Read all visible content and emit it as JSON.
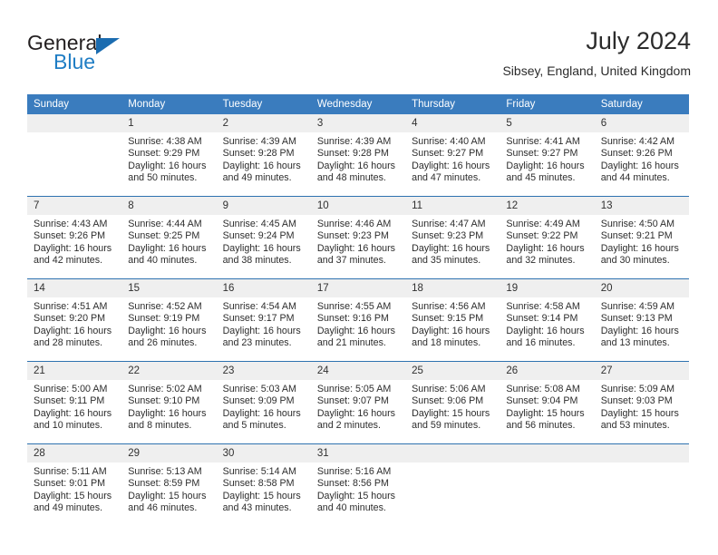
{
  "brand": {
    "name_part1": "General",
    "name_part2": "Blue",
    "flag_icon": "triangle-flag-icon"
  },
  "header": {
    "title": "July 2024",
    "location": "Sibsey, England, United Kingdom"
  },
  "colors": {
    "header_blue": "#3a7cbe",
    "row_divider_blue": "#2e72b0",
    "daynum_band": "#efefef",
    "brand_blue": "#1f7dc4"
  },
  "weekdays": [
    "Sunday",
    "Monday",
    "Tuesday",
    "Wednesday",
    "Thursday",
    "Friday",
    "Saturday"
  ],
  "weeks": [
    [
      {
        "day": "",
        "sunrise": "",
        "sunset": "",
        "daylight_line1": "",
        "daylight_line2": ""
      },
      {
        "day": "1",
        "sunrise": "Sunrise: 4:38 AM",
        "sunset": "Sunset: 9:29 PM",
        "daylight_line1": "Daylight: 16 hours",
        "daylight_line2": "and 50 minutes."
      },
      {
        "day": "2",
        "sunrise": "Sunrise: 4:39 AM",
        "sunset": "Sunset: 9:28 PM",
        "daylight_line1": "Daylight: 16 hours",
        "daylight_line2": "and 49 minutes."
      },
      {
        "day": "3",
        "sunrise": "Sunrise: 4:39 AM",
        "sunset": "Sunset: 9:28 PM",
        "daylight_line1": "Daylight: 16 hours",
        "daylight_line2": "and 48 minutes."
      },
      {
        "day": "4",
        "sunrise": "Sunrise: 4:40 AM",
        "sunset": "Sunset: 9:27 PM",
        "daylight_line1": "Daylight: 16 hours",
        "daylight_line2": "and 47 minutes."
      },
      {
        "day": "5",
        "sunrise": "Sunrise: 4:41 AM",
        "sunset": "Sunset: 9:27 PM",
        "daylight_line1": "Daylight: 16 hours",
        "daylight_line2": "and 45 minutes."
      },
      {
        "day": "6",
        "sunrise": "Sunrise: 4:42 AM",
        "sunset": "Sunset: 9:26 PM",
        "daylight_line1": "Daylight: 16 hours",
        "daylight_line2": "and 44 minutes."
      }
    ],
    [
      {
        "day": "7",
        "sunrise": "Sunrise: 4:43 AM",
        "sunset": "Sunset: 9:26 PM",
        "daylight_line1": "Daylight: 16 hours",
        "daylight_line2": "and 42 minutes."
      },
      {
        "day": "8",
        "sunrise": "Sunrise: 4:44 AM",
        "sunset": "Sunset: 9:25 PM",
        "daylight_line1": "Daylight: 16 hours",
        "daylight_line2": "and 40 minutes."
      },
      {
        "day": "9",
        "sunrise": "Sunrise: 4:45 AM",
        "sunset": "Sunset: 9:24 PM",
        "daylight_line1": "Daylight: 16 hours",
        "daylight_line2": "and 38 minutes."
      },
      {
        "day": "10",
        "sunrise": "Sunrise: 4:46 AM",
        "sunset": "Sunset: 9:23 PM",
        "daylight_line1": "Daylight: 16 hours",
        "daylight_line2": "and 37 minutes."
      },
      {
        "day": "11",
        "sunrise": "Sunrise: 4:47 AM",
        "sunset": "Sunset: 9:23 PM",
        "daylight_line1": "Daylight: 16 hours",
        "daylight_line2": "and 35 minutes."
      },
      {
        "day": "12",
        "sunrise": "Sunrise: 4:49 AM",
        "sunset": "Sunset: 9:22 PM",
        "daylight_line1": "Daylight: 16 hours",
        "daylight_line2": "and 32 minutes."
      },
      {
        "day": "13",
        "sunrise": "Sunrise: 4:50 AM",
        "sunset": "Sunset: 9:21 PM",
        "daylight_line1": "Daylight: 16 hours",
        "daylight_line2": "and 30 minutes."
      }
    ],
    [
      {
        "day": "14",
        "sunrise": "Sunrise: 4:51 AM",
        "sunset": "Sunset: 9:20 PM",
        "daylight_line1": "Daylight: 16 hours",
        "daylight_line2": "and 28 minutes."
      },
      {
        "day": "15",
        "sunrise": "Sunrise: 4:52 AM",
        "sunset": "Sunset: 9:19 PM",
        "daylight_line1": "Daylight: 16 hours",
        "daylight_line2": "and 26 minutes."
      },
      {
        "day": "16",
        "sunrise": "Sunrise: 4:54 AM",
        "sunset": "Sunset: 9:17 PM",
        "daylight_line1": "Daylight: 16 hours",
        "daylight_line2": "and 23 minutes."
      },
      {
        "day": "17",
        "sunrise": "Sunrise: 4:55 AM",
        "sunset": "Sunset: 9:16 PM",
        "daylight_line1": "Daylight: 16 hours",
        "daylight_line2": "and 21 minutes."
      },
      {
        "day": "18",
        "sunrise": "Sunrise: 4:56 AM",
        "sunset": "Sunset: 9:15 PM",
        "daylight_line1": "Daylight: 16 hours",
        "daylight_line2": "and 18 minutes."
      },
      {
        "day": "19",
        "sunrise": "Sunrise: 4:58 AM",
        "sunset": "Sunset: 9:14 PM",
        "daylight_line1": "Daylight: 16 hours",
        "daylight_line2": "and 16 minutes."
      },
      {
        "day": "20",
        "sunrise": "Sunrise: 4:59 AM",
        "sunset": "Sunset: 9:13 PM",
        "daylight_line1": "Daylight: 16 hours",
        "daylight_line2": "and 13 minutes."
      }
    ],
    [
      {
        "day": "21",
        "sunrise": "Sunrise: 5:00 AM",
        "sunset": "Sunset: 9:11 PM",
        "daylight_line1": "Daylight: 16 hours",
        "daylight_line2": "and 10 minutes."
      },
      {
        "day": "22",
        "sunrise": "Sunrise: 5:02 AM",
        "sunset": "Sunset: 9:10 PM",
        "daylight_line1": "Daylight: 16 hours",
        "daylight_line2": "and 8 minutes."
      },
      {
        "day": "23",
        "sunrise": "Sunrise: 5:03 AM",
        "sunset": "Sunset: 9:09 PM",
        "daylight_line1": "Daylight: 16 hours",
        "daylight_line2": "and 5 minutes."
      },
      {
        "day": "24",
        "sunrise": "Sunrise: 5:05 AM",
        "sunset": "Sunset: 9:07 PM",
        "daylight_line1": "Daylight: 16 hours",
        "daylight_line2": "and 2 minutes."
      },
      {
        "day": "25",
        "sunrise": "Sunrise: 5:06 AM",
        "sunset": "Sunset: 9:06 PM",
        "daylight_line1": "Daylight: 15 hours",
        "daylight_line2": "and 59 minutes."
      },
      {
        "day": "26",
        "sunrise": "Sunrise: 5:08 AM",
        "sunset": "Sunset: 9:04 PM",
        "daylight_line1": "Daylight: 15 hours",
        "daylight_line2": "and 56 minutes."
      },
      {
        "day": "27",
        "sunrise": "Sunrise: 5:09 AM",
        "sunset": "Sunset: 9:03 PM",
        "daylight_line1": "Daylight: 15 hours",
        "daylight_line2": "and 53 minutes."
      }
    ],
    [
      {
        "day": "28",
        "sunrise": "Sunrise: 5:11 AM",
        "sunset": "Sunset: 9:01 PM",
        "daylight_line1": "Daylight: 15 hours",
        "daylight_line2": "and 49 minutes."
      },
      {
        "day": "29",
        "sunrise": "Sunrise: 5:13 AM",
        "sunset": "Sunset: 8:59 PM",
        "daylight_line1": "Daylight: 15 hours",
        "daylight_line2": "and 46 minutes."
      },
      {
        "day": "30",
        "sunrise": "Sunrise: 5:14 AM",
        "sunset": "Sunset: 8:58 PM",
        "daylight_line1": "Daylight: 15 hours",
        "daylight_line2": "and 43 minutes."
      },
      {
        "day": "31",
        "sunrise": "Sunrise: 5:16 AM",
        "sunset": "Sunset: 8:56 PM",
        "daylight_line1": "Daylight: 15 hours",
        "daylight_line2": "and 40 minutes."
      },
      {
        "day": "",
        "sunrise": "",
        "sunset": "",
        "daylight_line1": "",
        "daylight_line2": ""
      },
      {
        "day": "",
        "sunrise": "",
        "sunset": "",
        "daylight_line1": "",
        "daylight_line2": ""
      },
      {
        "day": "",
        "sunrise": "",
        "sunset": "",
        "daylight_line1": "",
        "daylight_line2": ""
      }
    ]
  ]
}
